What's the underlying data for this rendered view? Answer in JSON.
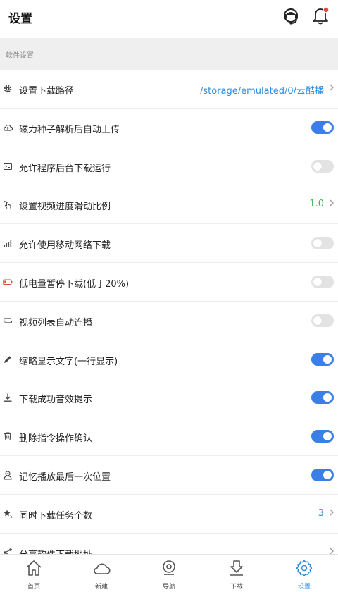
{
  "header": {
    "title": "设置"
  },
  "section": {
    "title": "软件设置"
  },
  "colors": {
    "accent": "#3a7ee6",
    "path_blue": "#2a8be0",
    "value_green": "#3fb34f",
    "value_teal": "#2a9fd0",
    "battery_red": "#e24b3b"
  },
  "rows": [
    {
      "label": "设置下载路径",
      "icon": "gear-icon",
      "value": "/storage/emulated/0/云酷播"
    },
    {
      "label": "磁力种子解析后自动上传",
      "icon": "cloud-upload-icon",
      "toggle": "on"
    },
    {
      "label": "允许程序后台下载运行",
      "icon": "background-window-icon",
      "toggle": "off"
    },
    {
      "label": "设置视频进度滑动比例",
      "icon": "swipe-hand-icon",
      "value": "1.0"
    },
    {
      "label": "允许使用移动网络下载",
      "icon": "signal-bars-icon",
      "toggle": "off"
    },
    {
      "label": "低电量暂停下载(低于20%)",
      "icon": "battery-low-icon",
      "toggle": "off"
    },
    {
      "label": "视频列表自动连播",
      "icon": "loop-icon",
      "toggle": "off"
    },
    {
      "label": "缩略显示文字(一行显示)",
      "icon": "pencil-icon",
      "toggle": "on"
    },
    {
      "label": "下载成功音效提示",
      "icon": "download-icon",
      "toggle": "on"
    },
    {
      "label": "删除指令操作确认",
      "icon": "trash-icon",
      "toggle": "on"
    },
    {
      "label": "记忆播放最后一次位置",
      "icon": "memory-person-icon",
      "toggle": "on"
    },
    {
      "label": "同时下载任务个数",
      "icon": "star-pin-icon",
      "value": "3"
    },
    {
      "label": "分享软件下载地址",
      "icon": "share-icon"
    }
  ],
  "tabs": [
    {
      "label": "首页",
      "icon": "home-icon"
    },
    {
      "label": "新建",
      "icon": "cloud-icon"
    },
    {
      "label": "导航",
      "icon": "location-icon"
    },
    {
      "label": "下载",
      "icon": "download-tab-icon"
    },
    {
      "label": "设置",
      "icon": "settings-gear-icon",
      "active": true
    }
  ]
}
